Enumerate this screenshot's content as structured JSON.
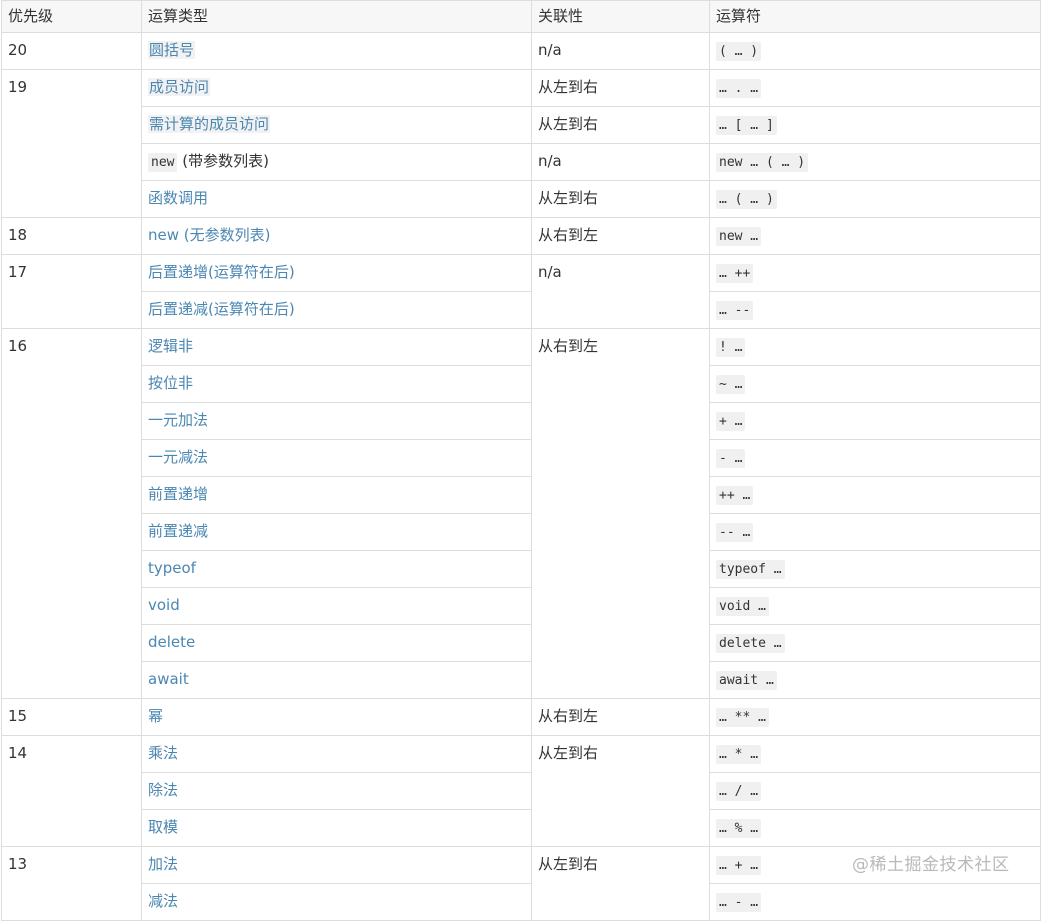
{
  "headers": [
    "优先级",
    "运算类型",
    "关联性",
    "运算符"
  ],
  "rows": [
    {
      "precedence": "20",
      "type": "圆括号",
      "assoc": "n/a",
      "op": "( … )"
    },
    {
      "precedence": "19",
      "type": "成员访问",
      "assoc": "从左到右",
      "op": "… . …"
    },
    {
      "type": "需计算的成员访问",
      "assoc": "从左到右",
      "op": "… [ … ]"
    },
    {
      "type_code": "new",
      "type_rest": " (带参数列表)",
      "assoc": "n/a",
      "op": "new … ( … )"
    },
    {
      "type": "函数调用",
      "assoc": "从左到右",
      "op": "… ( … )"
    },
    {
      "precedence": "18",
      "type": "new (无参数列表)",
      "assoc": "从右到左",
      "op": "new …"
    },
    {
      "precedence": "17",
      "type": "后置递增(运算符在后)",
      "assoc": "n/a",
      "op": "… ++"
    },
    {
      "type": "后置递减(运算符在后)",
      "op": "… --"
    },
    {
      "precedence": "16",
      "type": "逻辑非",
      "assoc": "从右到左",
      "op": "! …"
    },
    {
      "type": "按位非",
      "op": "~ …"
    },
    {
      "type": "一元加法",
      "op": "+ …"
    },
    {
      "type": "一元减法",
      "op": "- …"
    },
    {
      "type": "前置递增",
      "op": "++ …"
    },
    {
      "type": "前置递减",
      "op": "-- …"
    },
    {
      "type": "typeof",
      "op": "typeof …"
    },
    {
      "type": "void",
      "op": "void …"
    },
    {
      "type": "delete",
      "op": "delete …"
    },
    {
      "type": "await",
      "op": "await …"
    },
    {
      "precedence": "15",
      "type": "幂",
      "assoc": "从右到左",
      "op": "… ** …"
    },
    {
      "precedence": "14",
      "type": "乘法",
      "assoc": "从左到右",
      "op": "… * …"
    },
    {
      "type": "除法",
      "op": "… / …"
    },
    {
      "type": "取模",
      "op": "… % …"
    },
    {
      "precedence": "13",
      "type": "加法",
      "assoc": "从左到右",
      "op": "… + …"
    },
    {
      "type": "减法",
      "op": "… - …"
    }
  ],
  "watermark": "@稀土掘金技术社区"
}
